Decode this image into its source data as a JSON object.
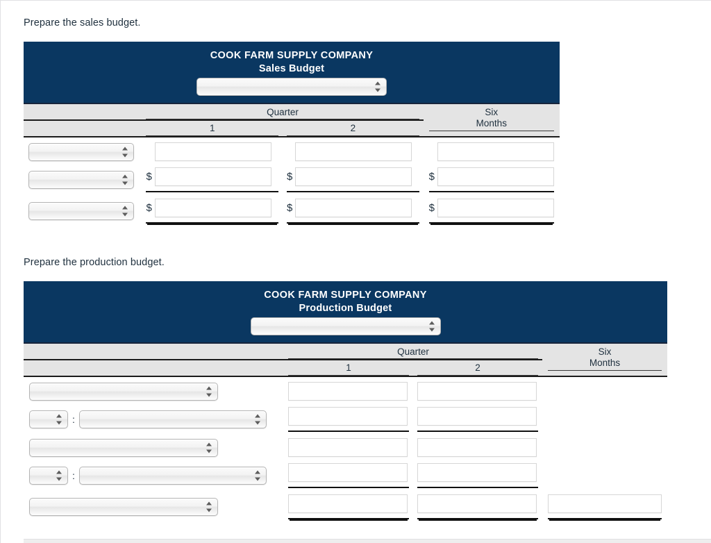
{
  "instructions": {
    "sales": "Prepare the sales budget.",
    "production": "Prepare the production budget."
  },
  "colors": {
    "header_navy": "#0a3761",
    "column_header_gray": "#e4e4e4",
    "rule_black": "#111111",
    "page_background": "#ffffff"
  },
  "sales_budget": {
    "company_name": "COOK FARM SUPPLY COMPANY",
    "statement_title": "Sales Budget",
    "period_select": {
      "value": "",
      "options": []
    },
    "columns": {
      "group_label": "Quarter",
      "quarter_1": "1",
      "quarter_2": "2",
      "six_months_line1": "Six",
      "six_months_line2": "Months"
    },
    "rows": [
      {
        "label_select": {
          "value": "",
          "options": []
        },
        "q1": {
          "currency": "",
          "value": ""
        },
        "q2": {
          "currency": "",
          "value": ""
        },
        "six": {
          "currency": "",
          "value": ""
        },
        "rule": "none"
      },
      {
        "label_select": {
          "value": "",
          "options": []
        },
        "q1": {
          "currency": "$",
          "value": ""
        },
        "q2": {
          "currency": "$",
          "value": ""
        },
        "six": {
          "currency": "$",
          "value": ""
        },
        "rule": "single"
      },
      {
        "label_select": {
          "value": "",
          "options": []
        },
        "q1": {
          "currency": "$",
          "value": ""
        },
        "q2": {
          "currency": "$",
          "value": ""
        },
        "six": {
          "currency": "$",
          "value": ""
        },
        "rule": "double"
      }
    ]
  },
  "production_budget": {
    "company_name": "COOK FARM SUPPLY COMPANY",
    "statement_title": "Production Budget",
    "period_select": {
      "value": "",
      "options": []
    },
    "columns": {
      "group_label": "Quarter",
      "quarter_1": "1",
      "quarter_2": "2",
      "six_months_line1": "Six",
      "six_months_line2": "Months"
    },
    "separator": ":",
    "rows": [
      {
        "type": "single-select",
        "label_select": {
          "value": "",
          "options": []
        },
        "q1": {
          "value": ""
        },
        "q2": {
          "value": ""
        },
        "six": {
          "value": null
        },
        "rule": "none"
      },
      {
        "type": "split-select",
        "prefix_select": {
          "value": "",
          "options": []
        },
        "label_select": {
          "value": "",
          "options": []
        },
        "q1": {
          "value": ""
        },
        "q2": {
          "value": ""
        },
        "six": {
          "value": null
        },
        "rule": "single"
      },
      {
        "type": "single-select",
        "label_select": {
          "value": "",
          "options": []
        },
        "q1": {
          "value": ""
        },
        "q2": {
          "value": ""
        },
        "six": {
          "value": null
        },
        "rule": "none"
      },
      {
        "type": "split-select",
        "prefix_select": {
          "value": "",
          "options": []
        },
        "label_select": {
          "value": "",
          "options": []
        },
        "q1": {
          "value": ""
        },
        "q2": {
          "value": ""
        },
        "six": {
          "value": null
        },
        "rule": "single"
      },
      {
        "type": "single-select",
        "label_select": {
          "value": "",
          "options": []
        },
        "q1": {
          "value": ""
        },
        "q2": {
          "value": ""
        },
        "six": {
          "value": ""
        },
        "rule": "double"
      }
    ]
  }
}
